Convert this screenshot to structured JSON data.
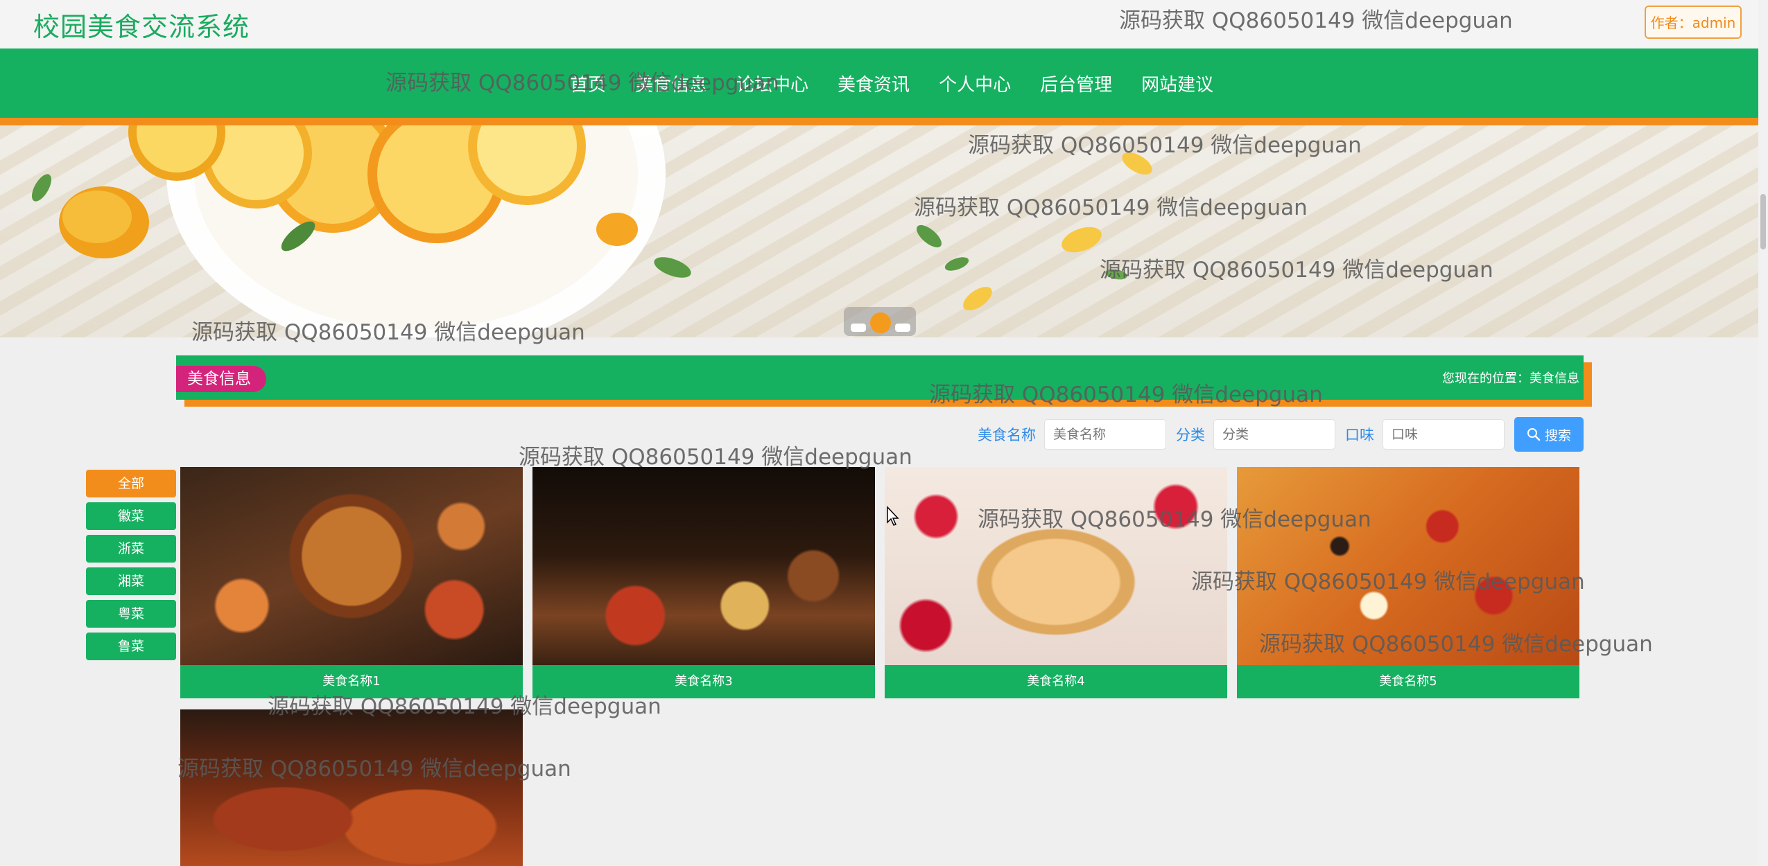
{
  "header": {
    "site_title": "校园美食交流系统",
    "author_label": "作者：admin"
  },
  "nav": {
    "items": [
      {
        "label": "首页"
      },
      {
        "label": "美食信息"
      },
      {
        "label": "论坛中心"
      },
      {
        "label": "美食资讯"
      },
      {
        "label": "个人中心"
      },
      {
        "label": "后台管理"
      },
      {
        "label": "网站建议"
      }
    ]
  },
  "section": {
    "title": "美食信息",
    "breadcrumb": "您现在的位置：美食信息"
  },
  "search": {
    "name_label": "美食名称",
    "name_placeholder": "美食名称",
    "category_label": "分类",
    "category_placeholder": "分类",
    "taste_label": "口味",
    "taste_placeholder": "口味",
    "button_label": "搜索"
  },
  "categories": [
    {
      "label": "全部",
      "active": true
    },
    {
      "label": "徽菜",
      "active": false
    },
    {
      "label": "浙菜",
      "active": false
    },
    {
      "label": "湘菜",
      "active": false
    },
    {
      "label": "粤菜",
      "active": false
    },
    {
      "label": "鲁菜",
      "active": false
    }
  ],
  "foods": [
    {
      "name": "美食名称1",
      "image": "hotpot-feast-photo"
    },
    {
      "name": "美食名称3",
      "image": "chinese-banquet-photo"
    },
    {
      "name": "美食名称4",
      "image": "pancake-stack-photo"
    },
    {
      "name": "美食名称5",
      "image": "pizza-photo"
    },
    {
      "name": "",
      "image": "grilled-meat-photo"
    }
  ],
  "watermark_text": "源码获取 QQ86050149 微信deepguan",
  "colors": {
    "primary_green": "#16b061",
    "accent_orange": "#f28d1b",
    "pill_magenta": "#d4237a",
    "search_blue": "#409eff",
    "title_green": "#1aab5f"
  }
}
